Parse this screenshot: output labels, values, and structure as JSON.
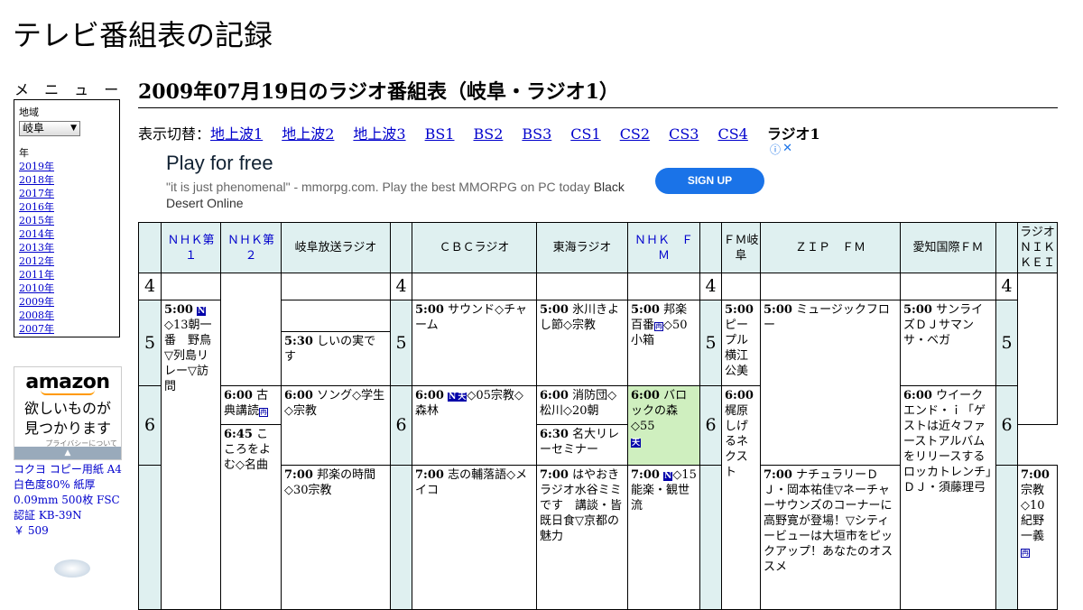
{
  "site": {
    "title": "テレビ番組表の記録"
  },
  "menu": {
    "heading": "メ ニ ュ ー",
    "region_label": "地域",
    "region_value": "岐阜",
    "year_label": "年",
    "years": [
      "2019年",
      "2018年",
      "2017年",
      "2016年",
      "2015年",
      "2014年",
      "2013年",
      "2012年",
      "2011年",
      "2010年",
      "2009年",
      "2008年",
      "2007年"
    ]
  },
  "amazon": {
    "logo": "amazon",
    "tagline1": "欲しいものが",
    "tagline2": "見つかります",
    "privacy": "プライバシーについて"
  },
  "product": {
    "text": "コクヨ コピー用紙 A4 白色度80% 紙厚 0.09mm 500枚 FSC認証 KB-39N",
    "price": "￥ 509"
  },
  "page": {
    "title": "2009年07月19日のラジオ番組表（岐阜・ラジオ1）"
  },
  "switcher": {
    "label": "表示切替：",
    "links": [
      "地上波1",
      "地上波2",
      "地上波3",
      "BS1",
      "BS2",
      "BS3",
      "CS1",
      "CS2",
      "CS3",
      "CS4"
    ],
    "current": "ラジオ1"
  },
  "ad": {
    "headline": "Play for free",
    "desc": "\"it is just phenomenal\" - mmorpg.com. Play the best MMORPG on PC today",
    "desc_bold": "Black Desert Online",
    "cta": "SIGN UP"
  },
  "channels": [
    "ＮＨＫ第１",
    "ＮＨＫ第２",
    "岐阜放送ラジオ",
    "ＣＢＣラジオ",
    "東海ラジオ",
    "ＮＨＫ　ＦＭ",
    "ＦＭ岐阜",
    "ＺＩＰ　ＦＭ",
    "愛知国際ＦＭ",
    "ラジオＮＩＫＫＥＩ"
  ],
  "hours": {
    "h4": "4",
    "h5": "5",
    "h6": "6"
  },
  "programs": {
    "nhk1_500_time": "5:00",
    "nhk1_500_title": "◇13朝一番　野鳥▽列島リレー▽訪問",
    "gifu_530_time": "5:30",
    "gifu_530_title": "しいの実です",
    "gifu_600_time": "6:00",
    "gifu_600_title": "ソング◇学生◇宗教",
    "gifu_700_time": "7:00",
    "gifu_700_title": "邦楽の時間◇30宗教",
    "nhk2_600_time": "6:00",
    "nhk2_600_title": "古典講読",
    "nhk2_645_time": "6:45",
    "nhk2_645_title": "こころをよむ◇名曲",
    "cbc_500_time": "5:00",
    "cbc_500_title": "サウンド◇チャーム",
    "cbc_600_time": "6:00",
    "cbc_600_title": "◇05宗教◇森林",
    "cbc_700_time": "7:00",
    "cbc_700_title": "志の輔落語◇メイコ",
    "tokai_500_time": "5:00",
    "tokai_500_title": "氷川きよし節◇宗教",
    "tokai_600_time": "6:00",
    "tokai_600_title": "消防団◇松川◇20朝",
    "tokai_630_time": "6:30",
    "tokai_630_title": "名大リレーセミナー",
    "tokai_700_time": "7:00",
    "tokai_700_title": "はやおきラジオ水谷ミミです　講談・皆既日食▽京都の魅力",
    "fm_500_time": "5:00",
    "fm_500_title": "邦楽百番",
    "fm_500_title2": "◇50小箱",
    "fm_600_time": "6:00",
    "fm_600_title": "バロックの森◇55",
    "fm_700_time": "7:00",
    "fm_700_title": "◇15能楽・観世流",
    "fmgifu_500_time": "5:00",
    "fmgifu_500_title": "ピープル横江公美",
    "fmgifu_600_time": "6:00",
    "fmgifu_600_title": "梶原しげるネクスト",
    "zip_500_time": "5:00",
    "zip_500_title": "ミュージックフロー",
    "zip_700_time": "7:00",
    "zip_700_title": "ナチュラリーＤＪ・岡本祐佳▽ネーチャーサウンズのコーナーに高野寛が登場！▽シティービューは大垣市をピックアップ！あなたのオススメ",
    "aichi_500_time": "5:00",
    "aichi_500_title": "サンライズＤＪサマンサ・ベガ",
    "aichi_600_time": "6:00",
    "aichi_600_title": "ウイークエンド・ｉ「ゲストは近々ファーストアルバムをリリースするロッカトレンチ」ＤＪ・須藤理弓",
    "nikkei_700_time": "7:00",
    "nikkei_700_title": "宗教◇10紀野一義"
  },
  "marks": {
    "news": "N",
    "weather": "天",
    "rebroadcast": "再"
  }
}
